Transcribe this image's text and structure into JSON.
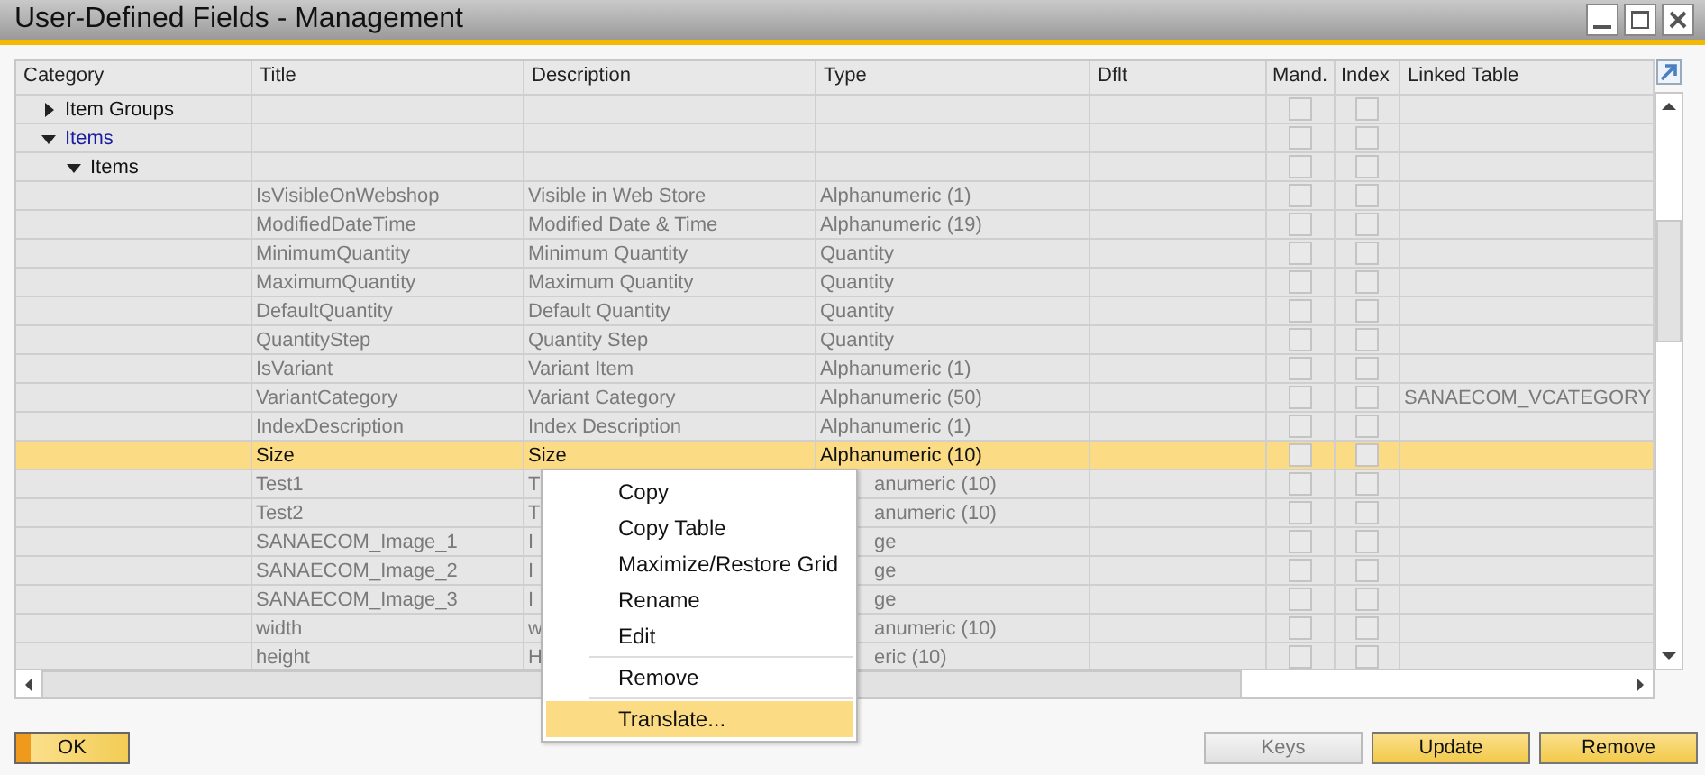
{
  "window": {
    "title": "User-Defined Fields - Management"
  },
  "columns": [
    "Category",
    "Title",
    "Description",
    "Type",
    "Dflt",
    "Mand.",
    "Index",
    "Linked Table"
  ],
  "categories": [
    {
      "label": "Item Groups",
      "expanded": false,
      "active": false,
      "mandatory": false,
      "index": false
    },
    {
      "label": "Items",
      "expanded": true,
      "active": true,
      "mandatory": false,
      "index": false,
      "children": [
        {
          "label": "Items",
          "expanded": true,
          "active": false,
          "mandatory": false,
          "index": false,
          "fields": [
            {
              "title": "IsVisibleOnWebshop",
              "description": "Visible in Web Store",
              "type": "Alphanumeric (1)",
              "mandatory": false,
              "index": false,
              "selected": false
            },
            {
              "title": "ModifiedDateTime",
              "description": "Modified Date & Time",
              "type": "Alphanumeric (19)",
              "mandatory": false,
              "index": false,
              "selected": false
            },
            {
              "title": "MinimumQuantity",
              "description": "Minimum Quantity",
              "type": "Quantity",
              "mandatory": false,
              "index": false,
              "selected": false
            },
            {
              "title": "MaximumQuantity",
              "description": "Maximum Quantity",
              "type": "Quantity",
              "mandatory": false,
              "index": false,
              "selected": false
            },
            {
              "title": "DefaultQuantity",
              "description": "Default Quantity",
              "type": "Quantity",
              "mandatory": false,
              "index": false,
              "selected": false
            },
            {
              "title": "QuantityStep",
              "description": "Quantity Step",
              "type": "Quantity",
              "mandatory": false,
              "index": false,
              "selected": false
            },
            {
              "title": "IsVariant",
              "description": "Variant Item",
              "type": "Alphanumeric (1)",
              "mandatory": false,
              "index": false,
              "selected": false
            },
            {
              "title": "VariantCategory",
              "description": "Variant Category",
              "type": "Alphanumeric (50)",
              "linked_table": "SANAECOM_VCATEGORY",
              "mandatory": false,
              "index": false,
              "selected": false
            },
            {
              "title": "IndexDescription",
              "description": "Index Description",
              "type": "Alphanumeric (1)",
              "mandatory": false,
              "index": false,
              "selected": false
            },
            {
              "title": "Size",
              "description": "Size",
              "type": "Alphanumeric (10)",
              "mandatory": false,
              "index": false,
              "selected": true
            },
            {
              "title": "Test1",
              "description": "T",
              "type": "anumeric (10)",
              "mandatory": false,
              "index": false,
              "selected": false
            },
            {
              "title": "Test2",
              "description": "T",
              "type": "anumeric (10)",
              "mandatory": false,
              "index": false,
              "selected": false
            },
            {
              "title": "SANAECOM_Image_1",
              "description": "I",
              "type": "ge",
              "mandatory": false,
              "index": false,
              "selected": false
            },
            {
              "title": "SANAECOM_Image_2",
              "description": "I",
              "type": "ge",
              "mandatory": false,
              "index": false,
              "selected": false
            },
            {
              "title": "SANAECOM_Image_3",
              "description": "I",
              "type": "ge",
              "mandatory": false,
              "index": false,
              "selected": false
            },
            {
              "title": "width",
              "description": "w",
              "type": "anumeric (10)",
              "mandatory": false,
              "index": false,
              "selected": false
            },
            {
              "title": "height",
              "description": "H",
              "type": "eric (10)",
              "mandatory": false,
              "index": false,
              "selected": false
            }
          ]
        }
      ]
    }
  ],
  "context_menu": [
    {
      "kind": "item",
      "label": "Copy",
      "selected": false
    },
    {
      "kind": "item",
      "label": "Copy Table",
      "selected": false
    },
    {
      "kind": "item",
      "label": "Maximize/Restore Grid",
      "selected": false
    },
    {
      "kind": "item",
      "label": "Rename",
      "selected": false
    },
    {
      "kind": "item",
      "label": "Edit",
      "selected": false
    },
    {
      "kind": "separator"
    },
    {
      "kind": "item",
      "label": "Remove",
      "selected": false
    },
    {
      "kind": "separator"
    },
    {
      "kind": "item",
      "label": "Translate...",
      "selected": true
    }
  ],
  "buttons_left": [
    {
      "label": "OK",
      "kind": "primary",
      "disabled": false
    }
  ],
  "buttons_right": [
    {
      "label": "Keys",
      "kind": "normal",
      "disabled": true
    },
    {
      "label": "Update",
      "kind": "normal",
      "disabled": false
    },
    {
      "label": "Remove",
      "kind": "normal",
      "disabled": false
    }
  ]
}
